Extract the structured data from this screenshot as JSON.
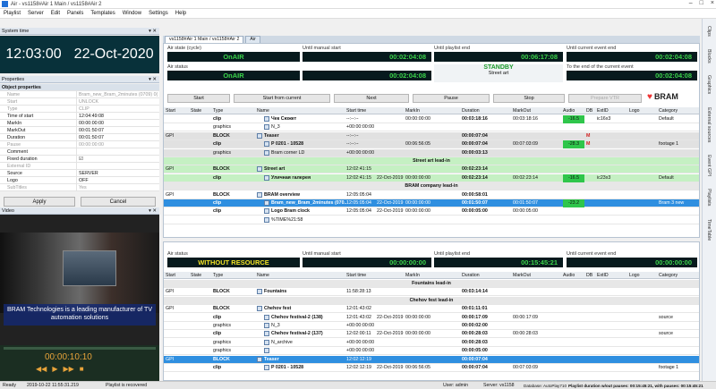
{
  "window": {
    "title": "Air - vs1158#Air 1 Main / vs1158#Air 2"
  },
  "menu": [
    "Playlist",
    "Server",
    "Edit",
    "Panels",
    "Templates",
    "Window",
    "Settings",
    "Help"
  ],
  "system_time": {
    "header": "System time",
    "time": "12:03:00",
    "date": "22-Oct-2020"
  },
  "properties": {
    "header": "Properties",
    "section": "Object properties",
    "rows": [
      {
        "k": "Name",
        "v": "Bram_new_Bram_2minutes (0709) 0(",
        "dim": true
      },
      {
        "k": "Start",
        "v": "UNLOCK",
        "dim": true
      },
      {
        "k": "Type",
        "v": "CLIP",
        "dim": true
      },
      {
        "k": "Time of start",
        "v": "12:04:49:08",
        "dim": false
      },
      {
        "k": "MarkIn",
        "v": "00:00:00:00",
        "dim": false
      },
      {
        "k": "MarkOut",
        "v": "00:01:50:07",
        "dim": false
      },
      {
        "k": "Duration",
        "v": "00:01:50:07",
        "dim": false
      },
      {
        "k": "Pause",
        "v": "00:00:00:00",
        "dim": true
      },
      {
        "k": "Comment",
        "v": "",
        "dim": false
      },
      {
        "k": "Fixed duration",
        "v": "☑",
        "dim": false
      },
      {
        "k": "External ID",
        "v": "",
        "dim": true
      },
      {
        "k": "Source",
        "v": "SERVER",
        "dim": false
      },
      {
        "k": "Logo",
        "v": "OFF",
        "dim": false
      },
      {
        "k": "SubTitles",
        "v": "Yes",
        "dim": true
      }
    ],
    "apply": "Apply",
    "cancel": "Cancel"
  },
  "video": {
    "header": "Video",
    "caption": "BRAM Technologies is a leading manufacturer of TV automation solutions",
    "timecode": "00:00:10:10"
  },
  "tabs": [
    "vs1158#Air 1 Main / vs1158#Air 2",
    "Air"
  ],
  "air1": {
    "labels": {
      "state": "Air state (cycle)",
      "manual": "Until manual start",
      "playlist_end": "Until playlist end",
      "event_end": "Until current event end",
      "status": "Air status",
      "to_end": "To the end of the current event"
    },
    "state": "OnAIR",
    "manual": "00:02:04:08",
    "playlist_end": "00:06:17:08",
    "event_end": "00:02:04:08",
    "status": "OnAIR",
    "to_end": "00:02:04:08",
    "standby": "STANDBY",
    "event_name": "Street art",
    "controls": [
      "Start",
      "Start from current",
      "Next",
      "Pause",
      "Stop",
      "Prepare VTR"
    ],
    "brand": "BRAM"
  },
  "columns1": [
    "Start",
    "State",
    "Type",
    "Name",
    "Start time",
    "MarkIn",
    "Duration",
    "MarkOut",
    "Audio",
    "DB",
    "ExtID",
    "Logo",
    "Category"
  ],
  "rows1": [
    {
      "cls": "",
      "type": "clip",
      "name": "Чек Сюжет",
      "start": "--:--:--",
      "markin": "00:00:00:00",
      "dur": "00:03:18:16",
      "markout": "00:03:18:16",
      "audio": "-16.5",
      "ext": "ic16x3",
      "cat": "Default"
    },
    {
      "cls": "",
      "type": "graphics",
      "name": "N_3",
      "start": "+00:00:00:00"
    },
    {
      "cls": "gray",
      "gpi": "GPI",
      "type": "BLOCK",
      "name": "Teaser",
      "start": "--:--:--",
      "dur": "00:00:07:04",
      "db": "M"
    },
    {
      "cls": "gray",
      "type": "clip",
      "name": "P 0201 - 10528",
      "start": "--:--:--",
      "markin": "00:06:56:05",
      "dur": "00:00:07:04",
      "markout": "00:07:03:09",
      "audio": "-28.3",
      "db": "M",
      "cat": "footage 1"
    },
    {
      "cls": "gray",
      "type": "graphics",
      "name": "Bram corner LD",
      "start": "+00:00:00:00",
      "dur": "00:00:03:13"
    },
    {
      "cls": "sep",
      "label": "Street art lead-in"
    },
    {
      "cls": "green",
      "gpi": "GPI",
      "type": "BLOCK",
      "name": "Street art",
      "start": "12:02:41:15",
      "dur": "00:02:23:14"
    },
    {
      "cls": "green",
      "type": "clip",
      "name": "Уличная галерея",
      "start": "12:02:41:15",
      "date": "22-Oct-2019",
      "markin": "00:00:00:00",
      "dur": "00:02:23:14",
      "markout": "00:02:23:14",
      "audio": "-16.5",
      "ext": "ic23x3",
      "cat": "Default"
    },
    {
      "cls": "sep",
      "label": "BRAM company lead-in"
    },
    {
      "cls": "",
      "gpi": "GPI",
      "type": "BLOCK",
      "name": "BRAM overview",
      "start": "12:05:05:04",
      "dur": "00:00:58:01"
    },
    {
      "cls": "blue",
      "type": "clip",
      "name": "Bram_new_Bram_2minutes (070...",
      "start": "12:05:05:04",
      "date": "22-Oct-2019",
      "markin": "00:00:00:00",
      "dur": "00:01:50:07",
      "markout": "00:01:50:07",
      "audio": "-23.2",
      "cat": "Bram 3 new"
    },
    {
      "cls": "",
      "type": "clip",
      "name": "Logo Bram clock",
      "start": "12:05:05:04",
      "date": "22-Oct-2019",
      "markin": "00:00:00:00",
      "dur": "00:00:05:00",
      "markout": "00:00:05:00"
    },
    {
      "cls": "",
      "type": "",
      "name": "%TIME%21:58",
      "start": ""
    }
  ],
  "air2": {
    "labels": {
      "status": "Air status",
      "manual": "Until manual start",
      "playlist_end": "Until playlist end",
      "event_end": "Until current event end"
    },
    "status": "WITHOUT RESOURCE",
    "manual": "00:00:00:00",
    "playlist_end": "00:15:45:21",
    "event_end": "00:00:00:00"
  },
  "columns2": [
    "Start",
    "State",
    "Type",
    "Name",
    "Start time",
    "MarkIn",
    "Duration",
    "MarkOut",
    "Audio",
    "DB",
    "ExtID",
    "Logo",
    "Category"
  ],
  "rows2": [
    {
      "cls": "sep",
      "label": "Fountains lead-in"
    },
    {
      "cls": "",
      "gpi": "GPI",
      "type": "BLOCK",
      "name": "Fountains",
      "start": "11:58:28:13",
      "dur": "00:03:14:14"
    },
    {
      "cls": "sep",
      "label": "Chehov fest lead-in"
    },
    {
      "cls": "",
      "gpi": "GPI",
      "type": "BLOCK",
      "name": "Chehov fest",
      "start": "12:01:43:02",
      "dur": "00:01:11:01"
    },
    {
      "cls": "",
      "type": "clip",
      "name": "Chehov festival-2 (138)",
      "start": "12:01:43:02",
      "date": "22-Oct-2019",
      "markin": "00:00:00:00",
      "dur": "00:00:17:09",
      "markout": "00:00:17:09",
      "cat": "source"
    },
    {
      "cls": "",
      "type": "graphics",
      "name": "N_3",
      "start": "+00:00:00:00",
      "dur": "00:00:02:00"
    },
    {
      "cls": "",
      "type": "clip",
      "name": "Chehov festival-2 (137)",
      "start": "12:02:00:11",
      "date": "22-Oct-2019",
      "markin": "00:00:00:00",
      "dur": "00:00:28:03",
      "markout": "00:00:28:03",
      "cat": "source"
    },
    {
      "cls": "",
      "type": "graphics",
      "name": "N_archive",
      "start": "+00:00:00:00",
      "dur": "00:00:28:03"
    },
    {
      "cls": "",
      "type": "graphics",
      "name": "",
      "start": "+00:00:00:00",
      "dur": "00:00:05:00"
    },
    {
      "cls": "blue",
      "gpi": "GPI",
      "type": "BLOCK",
      "name": "Teaser",
      "start": "12:02:12:19",
      "dur": "00:00:07:04"
    },
    {
      "cls": "",
      "type": "clip",
      "name": "P 0201 - 10528",
      "start": "12:02:12:19",
      "date": "22-Oct-2019",
      "markin": "00:06:56:05",
      "dur": "00:00:07:04",
      "markout": "00:07:03:09",
      "cat": "footage 1"
    }
  ],
  "right_tabs": [
    "Clips",
    "Blocks",
    "Graphics",
    "External sources",
    "Event GPI",
    "Playlists",
    "TimeTable"
  ],
  "statusbar": {
    "state": "Ready",
    "datetime": "2019-10-22 11:55:31.219",
    "msg": "Playlist is recovered",
    "user": "User: admin",
    "server": "Server: vs1158",
    "db": "Database: AutoPlay710",
    "duration": "Playlist duration w/out pauses: 00:15:45:21, with pauses: 00:15:45:21"
  }
}
